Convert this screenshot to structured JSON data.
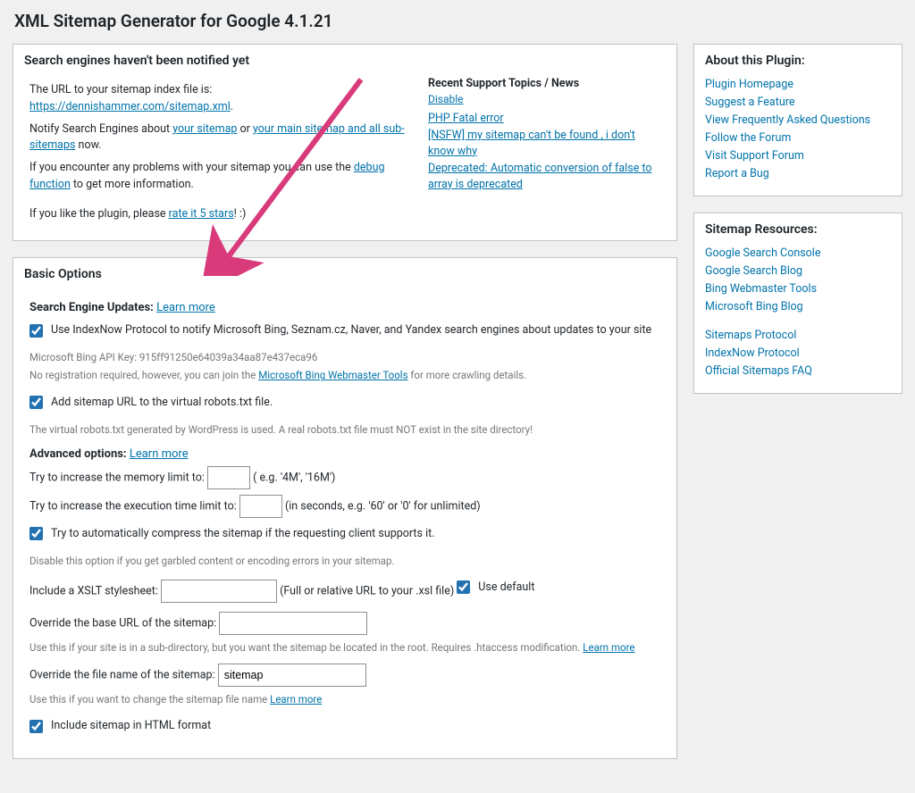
{
  "page_title": "XML Sitemap Generator for Google 4.1.21",
  "notify_box": {
    "title": "Search engines haven't been notified yet",
    "p1_a": "The URL to your sitemap index file is: ",
    "sitemap_url": "https://dennishammer.com/sitemap.xml",
    "p1_b": ".",
    "p2_a": "Notify Search Engines about ",
    "p2_link1": "your sitemap",
    "p2_b": " or ",
    "p2_link2": "your main sitemap and all sub-sitemaps",
    "p2_c": " now.",
    "p3_a": "If you encounter any problems with your sitemap you can use the ",
    "p3_link": "debug function",
    "p3_b": " to get more information.",
    "p4_a": "If you like the plugin, please ",
    "p4_link": "rate it 5 stars",
    "p4_b": "! :)",
    "news_title": "Recent Support Topics / News ",
    "news_disable": "Disable",
    "news_items": [
      "PHP Fatal error",
      "[NSFW] my sitemap can't be found , i don't know why",
      "Deprecated: Automatic conversion of false to array is deprecated"
    ]
  },
  "about": {
    "title": "About this Plugin:",
    "links": [
      "Plugin Homepage",
      "Suggest a Feature",
      "View Frequently Asked Questions",
      "Follow the Forum",
      "Visit Support Forum",
      "Report a Bug"
    ]
  },
  "resources": {
    "title": "Sitemap Resources:",
    "group1": [
      "Google Search Console",
      "Google Search Blog",
      "Bing Webmaster Tools",
      "Microsoft Bing Blog"
    ],
    "group2": [
      "Sitemaps Protocol",
      "IndexNow Protocol",
      "Official Sitemaps FAQ"
    ]
  },
  "basic": {
    "title": "Basic Options",
    "seu_label": "Search Engine Updates: ",
    "learn_more": "Learn more",
    "cb_indexnow": "Use IndexNow Protocol to notify Microsoft Bing, Seznam.cz, Naver, and Yandex search engines about updates to your site",
    "bing_key": "Microsoft Bing API Key: 915ff91250e64039a34aa87e437eca96",
    "no_reg_a": "No registration required, however, you can join the ",
    "no_reg_link": "Microsoft Bing Webmaster Tools",
    "no_reg_b": " for more crawling details.",
    "cb_robots": "Add sitemap URL to the virtual robots.txt file.",
    "robots_hint": "The virtual robots.txt generated by WordPress is used. A real robots.txt file must NOT exist in the site directory!",
    "adv_label": "Advanced options: ",
    "mem_label_a": "Try to increase the memory limit to: ",
    "mem_label_b": " ( e.g. '4M', '16M')",
    "exec_label_a": "Try to increase the execution time limit to: ",
    "exec_label_b": " (in seconds, e.g. '60' or '0' for unlimited)",
    "cb_compress": "Try to automatically compress the sitemap if the requesting client supports it.",
    "compress_hint": "Disable this option if you get garbled content or encoding errors in your sitemap.",
    "xslt_label_a": "Include a XSLT stylesheet: ",
    "xslt_label_b": " (Full or relative URL to your .xsl file) ",
    "cb_use_default": "Use default",
    "base_label": "Override the base URL of the sitemap: ",
    "base_hint": "Use this if your site is in a sub-directory, but you want the sitemap be located in the root. Requires .htaccess modification. ",
    "fname_label": "Override the file name of the sitemap: ",
    "fname_value": "sitemap",
    "fname_hint": "Use this if you want to change the sitemap file name ",
    "cb_html": "Include sitemap in HTML format"
  }
}
